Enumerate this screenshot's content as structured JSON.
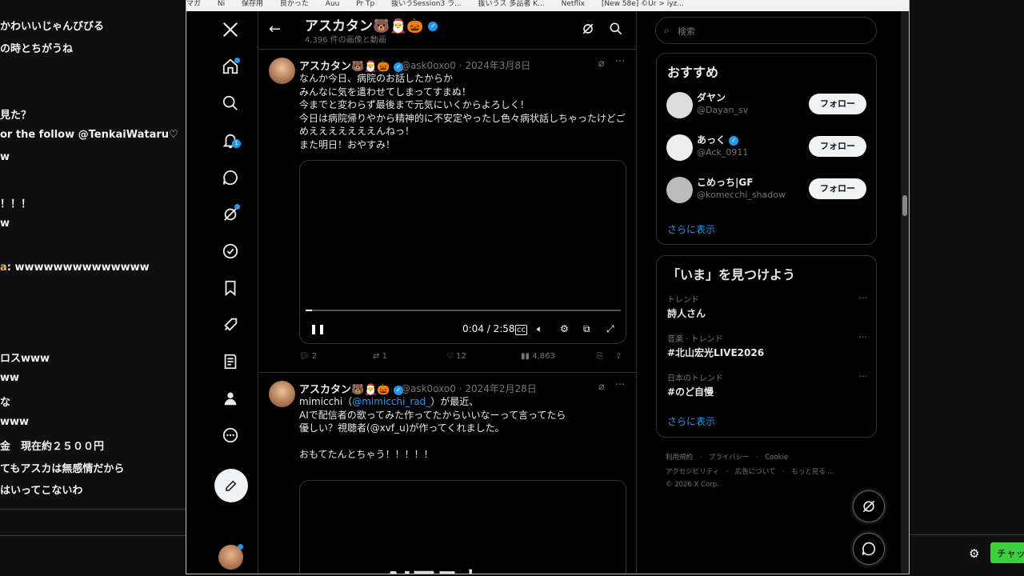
{
  "bg_chat": {
    "lines": [
      "かわいいじゃんびびる",
      "の時とちがうね",
      "見た？",
      "or the follow @TenkaiWataru♡",
      "w",
      "！！！",
      "w",
      "ロスwww",
      "ww",
      "な",
      "www",
      "金　現在約２５００円",
      "てもアスカは無感情だから",
      "はいってこないわ"
    ],
    "hl_name": "a",
    "hl_text": ": wwwwwwwwwwwwww",
    "chat_button": "チャッ"
  },
  "bookmarks": [
    "マガ",
    "Ni",
    "保存用",
    "良かった",
    "Auu",
    "Pr Tp",
    "抜いうSession3 ラ...",
    "抜いうス 多品者 K...",
    "Netflix",
    "[New 58e] ©Ur > iyz..."
  ],
  "nav": {
    "notification_count": "1"
  },
  "header": {
    "title": "アスカタン🐻🎅🎃",
    "subtitle": "4,396 件の画像と動画"
  },
  "tweet1": {
    "name": "アスカタン🐻🎅🎃",
    "handle": "@ask0oxo0",
    "date": "· 2024年3月8日",
    "text": "なんか今日、病院のお話したからか\nみんなに気を遣わせてしまってすまぬ！\n今までと変わらず最後まで元気にいくからよろしく！\n今日は病院帰りやから精神的に不安定やったし色々病状話しちゃったけどご\nめえええええええんねっ！\nまた明日！おやすみ！",
    "video_time": "0:04 / 2:58",
    "video_progress": 0.02,
    "replies": "2",
    "reposts": "1",
    "likes": "12",
    "views": "4,863"
  },
  "tweet2": {
    "name": "アスカタン🐻🎅🎃",
    "handle": "@ask0oxo0",
    "date": "· 2024年2月28日",
    "line1_pre": "mimicchi（",
    "line1_link": "@mimicchi_rad_",
    "line1_post": "）が最近、",
    "text_rest": "AIで配信者の歌ってみた作ってたからいいなーって言ってたら\n優しい？視聴者(@xvf_u)が作ってくれました。\n\nおもてたんとちゃう！！！！！",
    "video_title": "AIアスカ..."
  },
  "search": {
    "placeholder": "検索"
  },
  "who_to_follow": {
    "title": "おすすめ",
    "users": [
      {
        "name": "ダヤン",
        "handle": "@Dayan_sv",
        "button": "フォロー"
      },
      {
        "name": "あっく",
        "handle": "@Ack_0911",
        "button": "フォロー"
      },
      {
        "name": "こめっち|GF",
        "handle": "@komecchi_shadow",
        "button": "フォロー"
      }
    ],
    "show_more": "さらに表示"
  },
  "trends": {
    "title": "「いま」を見つけよう",
    "items": [
      {
        "category": "トレンド",
        "name": "詩人さん"
      },
      {
        "category": "音楽 · トレンド",
        "name": "#北山宏光LIVE2026"
      },
      {
        "category": "日本のトレンド",
        "name": "#のど自慢"
      }
    ],
    "show_more": "さらに表示"
  },
  "footer": {
    "line1": "利用規約　·　プライバシー　·　Cookie",
    "line2": "アクセシビリティ　·　広告について　·　もっと見る ...",
    "line3": "© 2026 X Corp."
  },
  "colors": {
    "accent": "#1d9bf0",
    "background": "#000000",
    "border": "#2f3336",
    "secondary_text": "#71767b"
  }
}
